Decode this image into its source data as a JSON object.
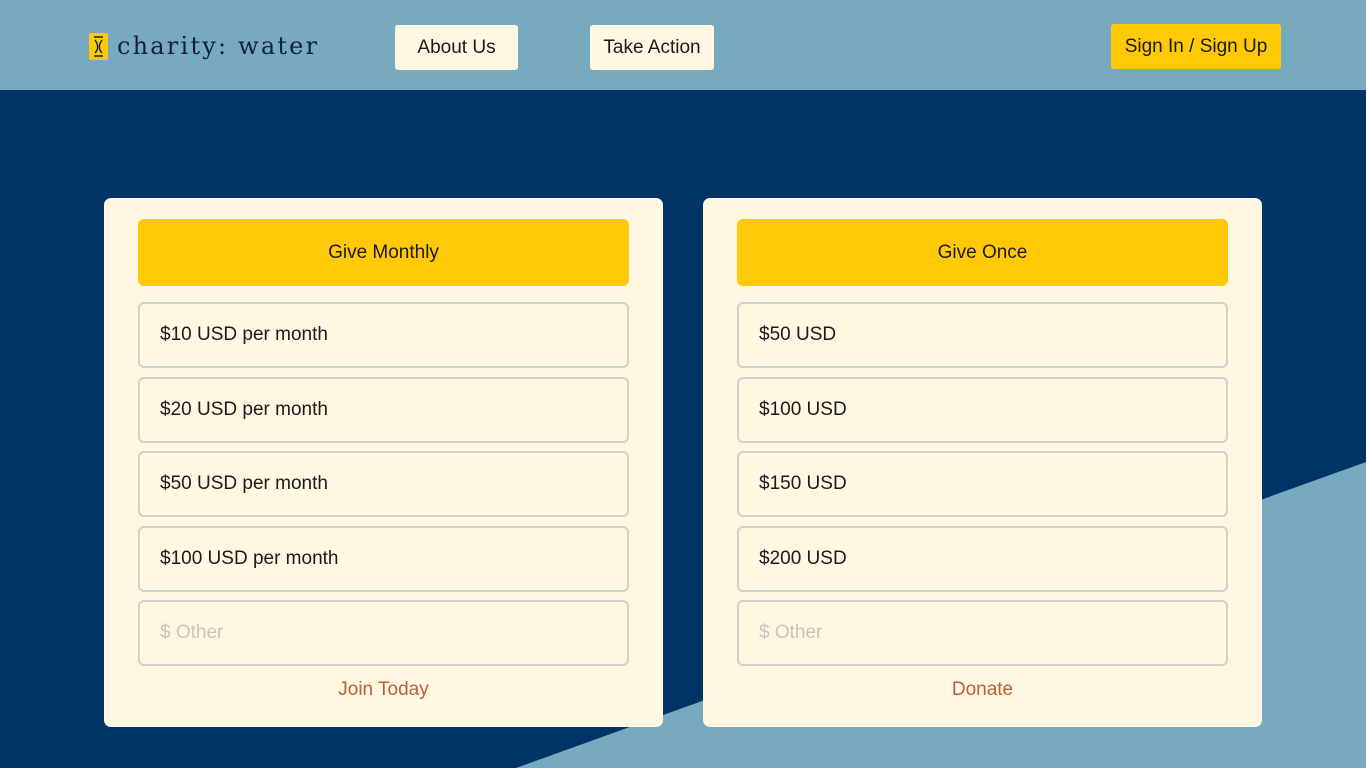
{
  "header": {
    "logo_text": "charity: water",
    "nav": [
      {
        "label": "About Us"
      },
      {
        "label": "Take Action"
      }
    ],
    "signin_label": "Sign In / Sign Up"
  },
  "monthly": {
    "heading": "Give Monthly",
    "options": [
      {
        "label": "$10 USD per month"
      },
      {
        "label": "$20 USD per month"
      },
      {
        "label": "$50 USD per month"
      },
      {
        "label": "$100 USD per month"
      }
    ],
    "other_placeholder": "$ Other",
    "link": "Join Today"
  },
  "once": {
    "heading": "Give Once",
    "options": [
      {
        "label": "$50 USD"
      },
      {
        "label": "$100 USD"
      },
      {
        "label": "$150 USD"
      },
      {
        "label": "$200 USD"
      }
    ],
    "other_placeholder": "$ Other",
    "link": "Donate"
  },
  "colors": {
    "brand_yellow": "#ffc907",
    "navy": "#003366",
    "light_blue": "#77a9bf",
    "cream": "#fff7e1",
    "link": "#b5603a"
  }
}
